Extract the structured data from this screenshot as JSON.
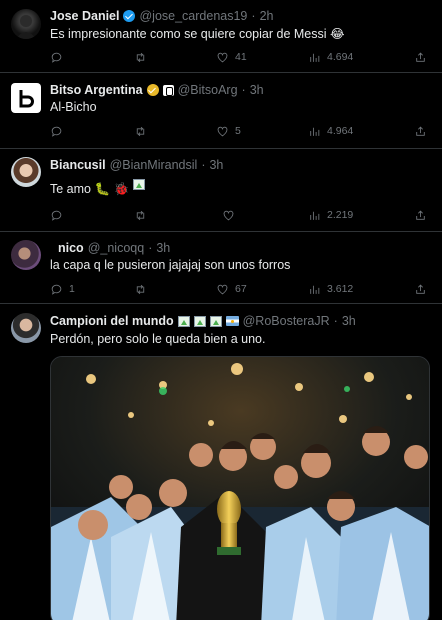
{
  "tweets": [
    {
      "name": "Jose Daniel",
      "handle": "@jose_cardenas19",
      "time": "2h",
      "text": "Es impresionante como se quiere copiar de Messi 😂",
      "replies": "",
      "retweets": "",
      "likes": "41",
      "views": "4.694"
    },
    {
      "name": "Bitso Argentina",
      "handle": "@BitsoArg",
      "time": "3h",
      "text": "Al-Bicho",
      "replies": "",
      "retweets": "",
      "likes": "5",
      "views": "4.964"
    },
    {
      "name": "Biancusil",
      "handle": "@BianMirandsil",
      "time": "3h",
      "text": "Te amo 🐛 🐞",
      "replies": "",
      "retweets": "",
      "likes": "",
      "views": "2.219"
    },
    {
      "name": "nico",
      "handle": "@_nicoqq",
      "time": "3h",
      "text": "la capa q le pusieron jajajaj son unos forros",
      "replies": "1",
      "retweets": "",
      "likes": "67",
      "views": "3.612"
    },
    {
      "name": "Campioni del mundo",
      "handle": "@RoBosteraJR",
      "time": "3h",
      "text": "Perdón, pero solo le queda bien a uno."
    }
  ],
  "separator": "·",
  "colors": {
    "background": "#000000",
    "text": "#e7e9ea",
    "muted": "#71767b",
    "verified_blue": "#1d9bf0",
    "verified_gold": "#e8b829",
    "divider": "#2f3336"
  },
  "icons": [
    "reply-icon",
    "retweet-icon",
    "like-icon",
    "views-icon",
    "share-icon"
  ]
}
